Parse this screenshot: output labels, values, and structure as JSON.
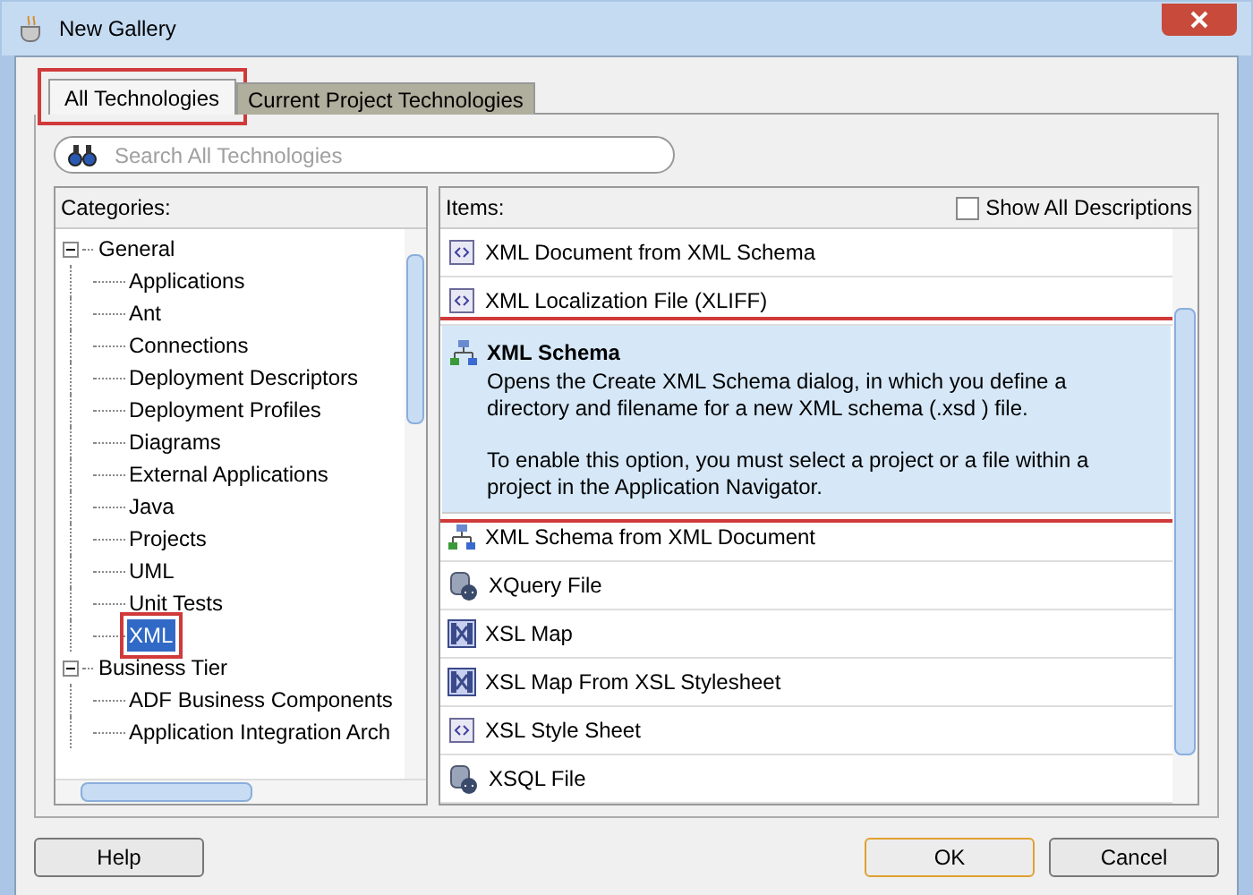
{
  "window": {
    "title": "New Gallery"
  },
  "tabs": [
    {
      "label": "All Technologies",
      "selected": true
    },
    {
      "label": "Current Project Technologies",
      "selected": false
    }
  ],
  "search": {
    "placeholder": "Search All Technologies"
  },
  "categories": {
    "label": "Categories:",
    "tree": [
      {
        "label": "General",
        "expanded": true,
        "selected": false,
        "children": [
          {
            "label": "Applications",
            "selected": false
          },
          {
            "label": "Ant",
            "selected": false
          },
          {
            "label": "Connections",
            "selected": false
          },
          {
            "label": "Deployment Descriptors",
            "selected": false
          },
          {
            "label": "Deployment Profiles",
            "selected": false
          },
          {
            "label": "Diagrams",
            "selected": false
          },
          {
            "label": "External Applications",
            "selected": false
          },
          {
            "label": "Java",
            "selected": false
          },
          {
            "label": "Projects",
            "selected": false
          },
          {
            "label": "UML",
            "selected": false
          },
          {
            "label": "Unit Tests",
            "selected": false
          },
          {
            "label": "XML",
            "selected": true
          }
        ]
      },
      {
        "label": "Business Tier",
        "expanded": true,
        "selected": false,
        "children": [
          {
            "label": "ADF Business Components",
            "selected": false
          },
          {
            "label": "Application Integration Arch",
            "selected": false
          }
        ]
      }
    ]
  },
  "items": {
    "label": "Items:",
    "show_all_descriptions": {
      "label": "Show All Descriptions",
      "checked": false
    },
    "list": [
      {
        "kind": "document",
        "title": "XML Document from XML Schema",
        "selected": false
      },
      {
        "kind": "document",
        "title": "XML Localization File (XLIFF)",
        "selected": false
      },
      {
        "kind": "schema",
        "title": "XML Schema",
        "selected": true,
        "description": [
          "Opens the Create XML Schema dialog, in which you define a directory and filename for a new XML schema (.xsd ) file.",
          "To enable this option, you must select a project or a file within a project in the Application Navigator."
        ]
      },
      {
        "kind": "schema",
        "title": "XML Schema from XML Document",
        "selected": false
      },
      {
        "kind": "database",
        "title": "XQuery File",
        "selected": false
      },
      {
        "kind": "map",
        "title": "XSL Map",
        "selected": false
      },
      {
        "kind": "map",
        "title": "XSL Map From XSL Stylesheet",
        "selected": false
      },
      {
        "kind": "document",
        "title": "XSL Style Sheet",
        "selected": false
      },
      {
        "kind": "database",
        "title": "XSQL File",
        "selected": false
      }
    ]
  },
  "buttons": {
    "help": "Help",
    "ok": "OK",
    "cancel": "Cancel"
  }
}
